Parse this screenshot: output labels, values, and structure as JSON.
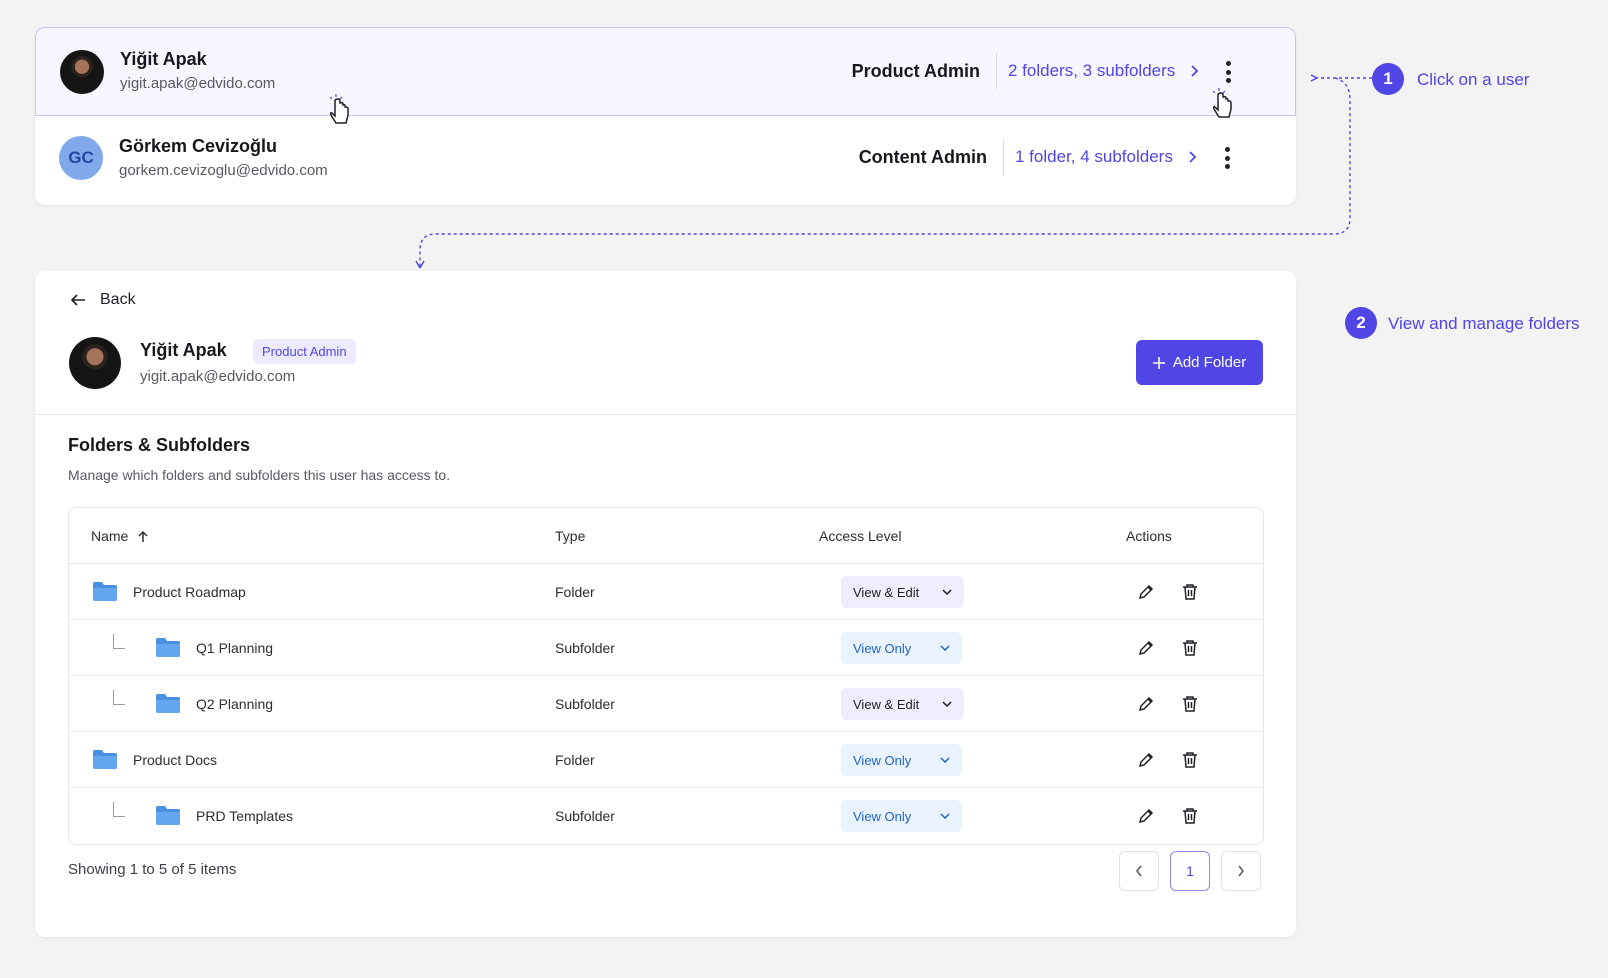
{
  "users": [
    {
      "name": "Yiğit Apak",
      "email": "yigit.apak@edvido.com",
      "role": "Product Admin",
      "folders": "2 folders, 3 subfolders"
    },
    {
      "name": "Görkem Cevizoğlu",
      "email": "gorkem.cevizoglu@edvido.com",
      "role": "Content Admin",
      "folders": "1 folder, 4 subfolders",
      "initials": "GC"
    }
  ],
  "annotations": {
    "step1_number": "1",
    "step1_label": "Click on a user",
    "step2_number": "2",
    "step2_label": "View and manage folders"
  },
  "detail": {
    "back_label": "Back",
    "user_name": "Yiğit Apak",
    "user_badge": "Product Admin",
    "user_email": "yigit.apak@edvido.com",
    "add_folder_label": "Add Folder",
    "section_title": "Folders & Subfolders",
    "section_desc": "Manage which folders and subfolders this user has access to.",
    "columns": {
      "name": "Name",
      "type": "Type",
      "access": "Access Level",
      "actions": "Actions"
    },
    "rows": [
      {
        "name": "Product Roadmap",
        "type": "Folder",
        "access": "View & Edit"
      },
      {
        "name": "Q1 Planning",
        "type": "Subfolder",
        "access": "View Only"
      },
      {
        "name": "Q2 Planning",
        "type": "Subfolder",
        "access": "View & Edit"
      },
      {
        "name": "Product Docs",
        "type": "Folder",
        "access": "View Only"
      },
      {
        "name": "PRD Templates",
        "type": "Subfolder",
        "access": "View Only"
      }
    ],
    "showing_text": "Showing 1 to 5 of 5 items",
    "current_page": "1"
  },
  "colors": {
    "accent": "#4f46e5",
    "folder": "#4a90e2",
    "view_only": "#2463c7"
  }
}
